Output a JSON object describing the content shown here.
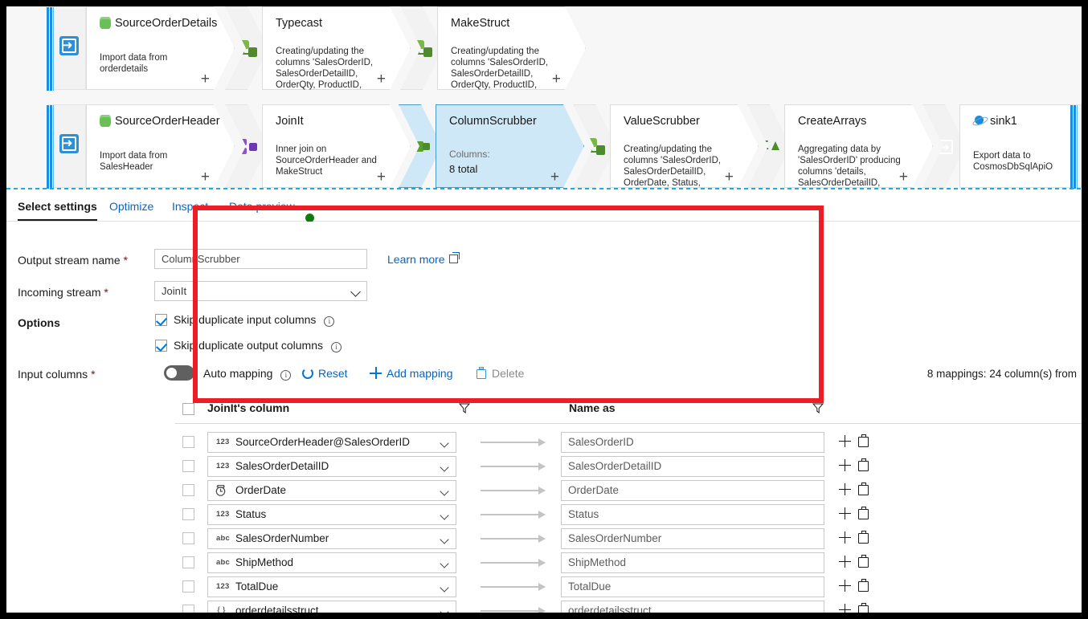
{
  "canvas": {
    "row1": [
      {
        "name": "SourceOrderDetails",
        "desc": "Import data from orderdetails",
        "source_icon": "sql-database-icon",
        "handle_icon": "source-arrow-icon",
        "type": "source"
      },
      {
        "name": "Typecast",
        "desc": "Creating/updating the columns 'SalesOrderID, SalesOrderDetailID, OrderQty, ProductID, UnitPrice,",
        "connector_icon": "derived-column-icon",
        "type": "transform"
      },
      {
        "name": "MakeStruct",
        "desc": "Creating/updating the columns 'SalesOrderID, SalesOrderDetailID, OrderQty, ProductID, UnitPrice,",
        "connector_icon": "derived-column-icon",
        "type": "transform"
      }
    ],
    "row2": [
      {
        "name": "SourceOrderHeader",
        "desc": "Import data from SalesHeader",
        "source_icon": "sql-database-icon",
        "handle_icon": "source-arrow-icon",
        "type": "source"
      },
      {
        "name": "JoinIt",
        "desc": "Inner join on SourceOrderHeader and MakeStruct",
        "connector_icon": "join-icon",
        "type": "transform"
      },
      {
        "name": "ColumnScrubber",
        "columns_label": "Columns:",
        "columns_value": "8 total",
        "connector_icon": "select-icon",
        "type": "transform",
        "selected": true
      },
      {
        "name": "ValueScrubber",
        "desc": "Creating/updating the columns 'SalesOrderID, SalesOrderDetailID, OrderDate, Status, SalesOrderNumber,",
        "connector_icon": "derived-column-icon",
        "type": "transform"
      },
      {
        "name": "CreateArrays",
        "desc": "Aggregating data by 'SalesOrderID' producing columns 'details, SalesOrderDetailID, OrderDate,",
        "connector_icon": "aggregate-icon",
        "type": "transform"
      },
      {
        "name": "sink1",
        "desc": "Export data to CosmosDbSqlApiOrders",
        "source_icon": "cosmos-db-icon",
        "connector_icon": "sink-icon",
        "type": "sink"
      }
    ],
    "plus_label": "+"
  },
  "tabs": [
    {
      "label": "Select settings",
      "active": true
    },
    {
      "label": "Optimize",
      "active": false
    },
    {
      "label": "Inspect",
      "active": false
    },
    {
      "label": "Data preview",
      "active": false,
      "status_dot": "#107c10"
    }
  ],
  "form": {
    "output_stream_label": "Output stream name",
    "output_stream_value": "ColumnScrubber",
    "incoming_stream_label": "Incoming stream",
    "incoming_stream_value": "JoinIt",
    "learn_more": "Learn more",
    "options_label": "Options",
    "skip_dup_input": "Skip duplicate input columns",
    "skip_dup_output": "Skip duplicate output columns",
    "input_columns_label": "Input columns",
    "required_mark": "*",
    "auto_mapping_label": "Auto mapping",
    "auto_mapping_on": false,
    "reset_label": "Reset",
    "add_mapping_label": "Add mapping",
    "delete_label": "Delete",
    "mapping_count": "8 mappings: 24 column(s) from"
  },
  "table": {
    "col_source_header": "JoinIt's column",
    "col_target_header": "Name as",
    "rows": [
      {
        "type_icon": "123",
        "source": "SourceOrderHeader@SalesOrderID",
        "target": "SalesOrderID"
      },
      {
        "type_icon": "123",
        "source": "SalesOrderDetailID",
        "target": "SalesOrderDetailID"
      },
      {
        "type_icon": "date",
        "source": "OrderDate",
        "target": "OrderDate"
      },
      {
        "type_icon": "123",
        "source": "Status",
        "target": "Status"
      },
      {
        "type_icon": "abc",
        "source": "SalesOrderNumber",
        "target": "SalesOrderNumber"
      },
      {
        "type_icon": "abc",
        "source": "ShipMethod",
        "target": "ShipMethod"
      },
      {
        "type_icon": "123",
        "source": "TotalDue",
        "target": "TotalDue"
      },
      {
        "type_icon": "{}",
        "source": "orderdetailsstruct",
        "target": "orderdetailsstruct"
      }
    ]
  },
  "colors": {
    "accent": "#0066cc",
    "highlight_box": "#ee1c25",
    "selected_node": "#cfe8f7",
    "status_green": "#107c10"
  }
}
